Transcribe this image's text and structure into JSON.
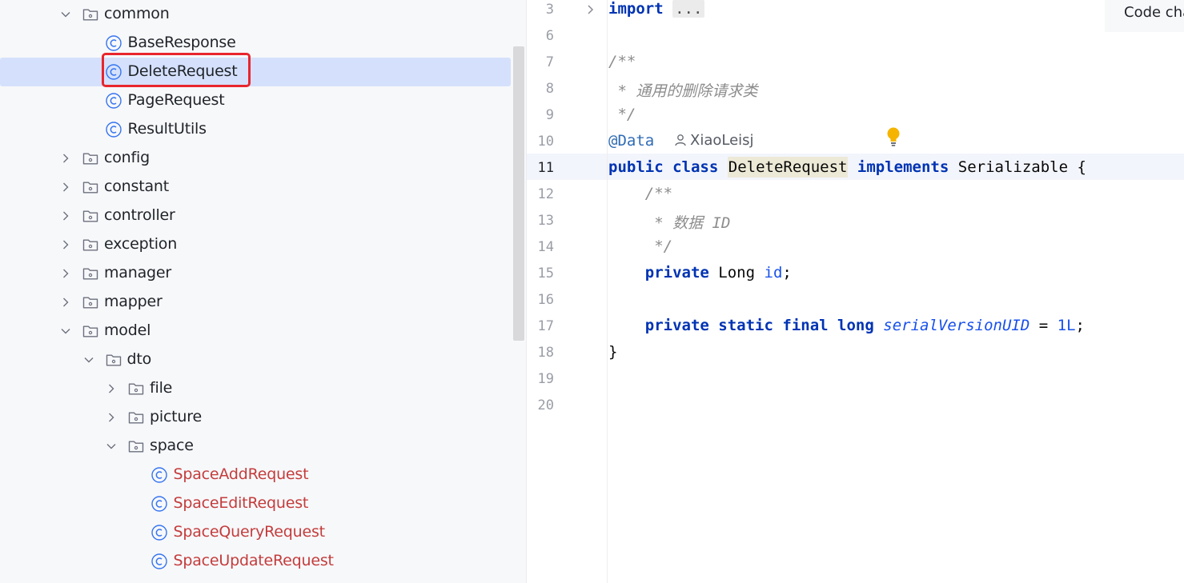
{
  "tree": {
    "items": [
      {
        "label": "common",
        "type": "folder",
        "expanded": true
      },
      {
        "label": "BaseResponse",
        "type": "class"
      },
      {
        "label": "DeleteRequest",
        "type": "class",
        "selected": true
      },
      {
        "label": "PageRequest",
        "type": "class"
      },
      {
        "label": "ResultUtils",
        "type": "class"
      },
      {
        "label": "config",
        "type": "folder",
        "expanded": false
      },
      {
        "label": "constant",
        "type": "folder",
        "expanded": false
      },
      {
        "label": "controller",
        "type": "folder",
        "expanded": false
      },
      {
        "label": "exception",
        "type": "folder",
        "expanded": false
      },
      {
        "label": "manager",
        "type": "folder",
        "expanded": false
      },
      {
        "label": "mapper",
        "type": "folder",
        "expanded": false
      },
      {
        "label": "model",
        "type": "folder",
        "expanded": true
      },
      {
        "label": "dto",
        "type": "folder",
        "expanded": true
      },
      {
        "label": "file",
        "type": "folder",
        "expanded": false
      },
      {
        "label": "picture",
        "type": "folder",
        "expanded": false
      },
      {
        "label": "space",
        "type": "folder",
        "expanded": true
      },
      {
        "label": "SpaceAddRequest",
        "type": "class",
        "modified": true
      },
      {
        "label": "SpaceEditRequest",
        "type": "class",
        "modified": true
      },
      {
        "label": "SpaceQueryRequest",
        "type": "class",
        "modified": true
      },
      {
        "label": "SpaceUpdateRequest",
        "type": "class",
        "modified": true
      }
    ]
  },
  "editor": {
    "line_numbers": [
      "3",
      "6",
      "7",
      "8",
      "9",
      "10",
      "11",
      "12",
      "13",
      "14",
      "15",
      "16",
      "17",
      "18",
      "19",
      "20"
    ],
    "current_line": "11",
    "code": {
      "import_kw": "import",
      "import_fold": "...",
      "doc_open": "/**",
      "doc_line": " * 通用的删除请求类",
      "doc_close": " */",
      "annotation": "@Data",
      "author": "XiaoLeisj",
      "l11_public": "public",
      "l11_class": "class",
      "l11_name": "DeleteRequest",
      "l11_implements": "implements",
      "l11_iface": "Serializable",
      "l11_brace": "{",
      "f_doc_open": "/**",
      "f_doc_line": " * 数据 ID",
      "f_doc_close": " */",
      "l15_private": "private",
      "l15_type": "Long",
      "l15_name": "id",
      "l15_semi": ";",
      "l17_private": "private",
      "l17_static": "static",
      "l17_final": "final",
      "l17_long": "long",
      "l17_name": "serialVersionUID",
      "l17_eq": "=",
      "l17_val": "1L",
      "l17_semi": ";",
      "close_brace": "}"
    },
    "code_change_label": "Code changes"
  },
  "colors": {
    "selection": "#d5e1fc",
    "highlight_box": "#e8262d",
    "keyword": "#0033b3",
    "modified_file": "#c43c3c"
  }
}
